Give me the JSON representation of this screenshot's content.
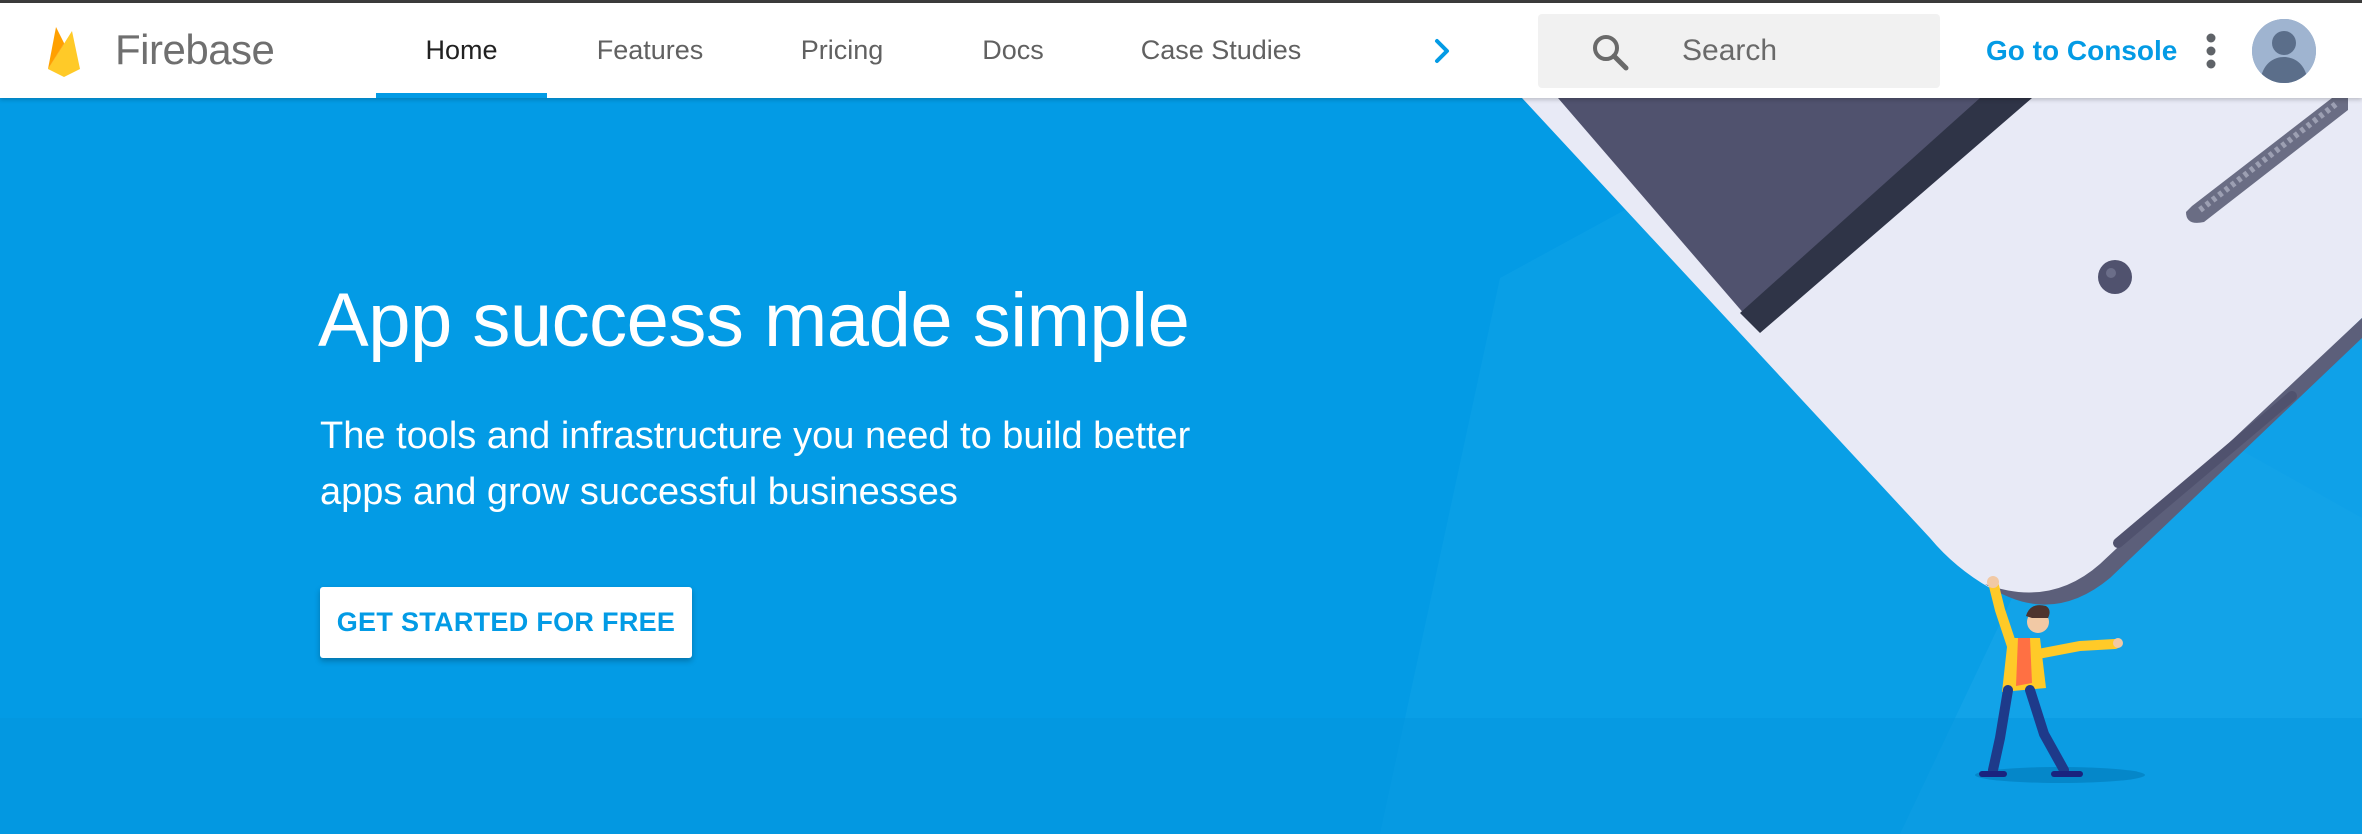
{
  "header": {
    "brand_name": "Firebase",
    "tabs": [
      {
        "label": "Home",
        "active": true
      },
      {
        "label": "Features",
        "active": false
      },
      {
        "label": "Pricing",
        "active": false
      },
      {
        "label": "Docs",
        "active": false
      },
      {
        "label": "Case Studies",
        "active": false
      }
    ],
    "search": {
      "placeholder": "Search",
      "value": ""
    },
    "console_link": "Go to Console",
    "icons": [
      "firebase-logo",
      "chevron-right-icon",
      "search-icon",
      "more-vert-icon",
      "avatar-icon"
    ]
  },
  "hero": {
    "title": "App success made simple",
    "subtitle": "The tools and infrastructure you need to build better apps and grow successful businesses",
    "cta_label": "GET STARTED FOR FREE"
  },
  "colors": {
    "brand_blue": "#039be5",
    "header_bg": "#ffffff",
    "phone_body": "#e8eaf6",
    "phone_screen": "#50526e",
    "firebase_yellow": "#ffca28",
    "firebase_orange": "#ffa000"
  }
}
